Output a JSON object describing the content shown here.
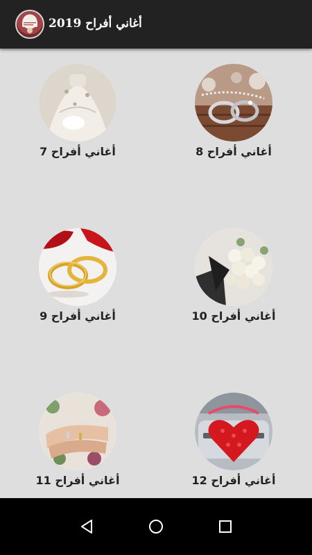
{
  "app_bar": {
    "title": "أغاني أفراح 2019",
    "icon": "app-logo-icon"
  },
  "grid": {
    "items": [
      {
        "label": "أغاني أفراح 8",
        "image": "wedding-rings-image"
      },
      {
        "label": "أغاني أفراح 7",
        "image": "bride-gloves-image"
      },
      {
        "label": "أغاني أفراح 10",
        "image": "white-rose-bouquet-image"
      },
      {
        "label": "أغاني أفراح 9",
        "image": "gold-rings-image"
      },
      {
        "label": "أغاني أفراح 12",
        "image": "red-heart-car-image"
      },
      {
        "label": "أغاني أفراح 11",
        "image": "hands-with-rings-image"
      }
    ]
  },
  "nav_bar": {
    "buttons": [
      "back-icon",
      "home-icon",
      "recents-icon"
    ]
  },
  "colors": {
    "app_bar": "#222222",
    "background": "#dedede",
    "nav_bar": "#000000",
    "label_text": "#222222"
  }
}
